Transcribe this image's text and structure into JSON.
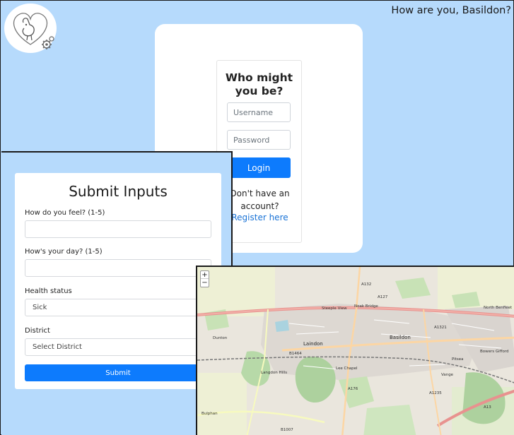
{
  "main_page": {
    "greeting": "How are you, Basildon?",
    "login": {
      "title": "Who might you be?",
      "username_placeholder": "Username",
      "password_placeholder": "Password",
      "login_label": "Login",
      "no_account_text": "Don't have an account?",
      "register_label": "Register here"
    },
    "colors": {
      "background": "#b6dafc",
      "primary": "#0d7bfd",
      "link": "#1a73d6"
    },
    "logo_icon": "dog-heart-gear-icon"
  },
  "submit_form": {
    "title": "Submit Inputs",
    "fields": [
      {
        "label": "How do you feel? (1-5)",
        "value": ""
      },
      {
        "label": "How's your day? (1-5)",
        "value": ""
      }
    ],
    "health_status": {
      "label": "Health status",
      "selected": "Sick"
    },
    "district": {
      "label": "District",
      "selected": "Select District"
    },
    "submit_label": "Submit"
  },
  "map": {
    "zoom_in": "+",
    "zoom_out": "−",
    "places": [
      {
        "name": "Basildon",
        "kind": "town"
      },
      {
        "name": "Laindon",
        "kind": "town"
      },
      {
        "name": "Langdon Hills",
        "kind": "town"
      },
      {
        "name": "Lee Chapel",
        "kind": "area"
      },
      {
        "name": "Vange",
        "kind": "area"
      },
      {
        "name": "Noak Bridge",
        "kind": "area"
      },
      {
        "name": "Steeple View",
        "kind": "area"
      },
      {
        "name": "Bowers Gifford",
        "kind": "area"
      },
      {
        "name": "North Benfleet",
        "kind": "area"
      },
      {
        "name": "Dunton",
        "kind": "area"
      },
      {
        "name": "Bulphan",
        "kind": "area"
      },
      {
        "name": "Pitsea",
        "kind": "area"
      }
    ],
    "roads": [
      "A127",
      "A132",
      "A176",
      "A1235",
      "A13",
      "A1321",
      "B1007",
      "B1464"
    ]
  }
}
